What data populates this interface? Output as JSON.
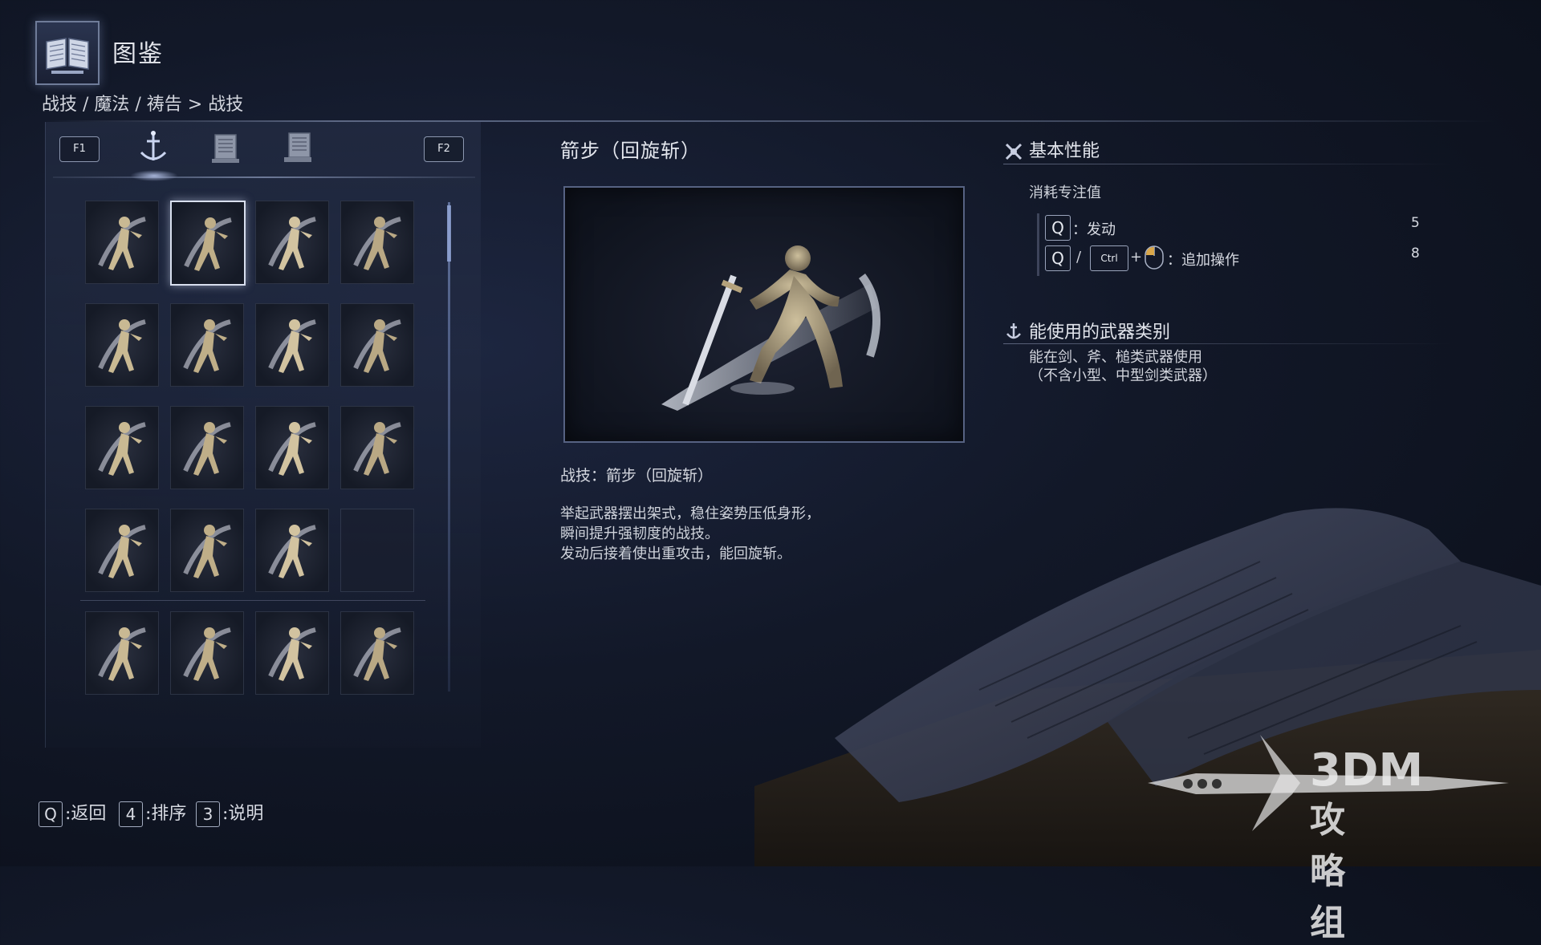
{
  "header": {
    "title": "图鉴",
    "icon": "book-icon"
  },
  "breadcrumb": "战技 / 魔法 / 祷告 > 战技",
  "tabs": {
    "f1_key": "F1",
    "f2_key": "F2",
    "items": [
      {
        "icon": "ash-of-war-icon",
        "active": true
      },
      {
        "icon": "sorcery-scroll-icon",
        "active": false
      },
      {
        "icon": "incantation-scroll-icon",
        "active": false
      }
    ]
  },
  "grid": {
    "selected_index": 1,
    "cells": [
      {
        "icon": "spin-slash-figure-icon"
      },
      {
        "icon": "quickstep-slash-figure-icon"
      },
      {
        "icon": "spinning-weapon-figure-icon"
      },
      {
        "icon": "lion-claw-figure-icon"
      },
      {
        "icon": "crystal-burst-icon"
      },
      {
        "icon": "kick-figure-icon"
      },
      {
        "icon": "roar-figure-icon"
      },
      {
        "icon": "war-cry-figure-icon"
      },
      {
        "icon": "ground-slam-spike-icon"
      },
      {
        "icon": "stomp-figure-icon"
      },
      {
        "icon": "endure-aura-figure-icon"
      },
      {
        "icon": "blood-aura-figure-icon"
      },
      {
        "icon": "blood-tax-figure-icon"
      },
      {
        "icon": "barricade-figure-icon"
      },
      {
        "icon": "vow-figure-icon"
      },
      {
        "icon": "empty-slot"
      },
      {
        "icon": "piercing-thrust-figure-icon"
      },
      {
        "icon": "impaling-thrust-figure-icon"
      },
      {
        "icon": "overhead-strike-figure-icon"
      },
      {
        "icon": "charge-thrust-figure-icon"
      }
    ]
  },
  "skill": {
    "name": "箭步（回旋斩）",
    "subtitle": "战技：箭步（回旋斩）",
    "description": [
      "举起武器摆出架式，稳住姿势压低身形，",
      "瞬间提升强韧度的战技。",
      "发动后接着使出重攻击，能回旋斩。"
    ]
  },
  "stats": {
    "heading": "基本性能",
    "fp_label": "消耗专注值",
    "rows": [
      {
        "key": "Q",
        "label": "：发动",
        "value": "5"
      },
      {
        "key": "Q",
        "sep": "/",
        "key2": "Ctrl",
        "plus": "+",
        "label": "：追加操作",
        "value": "8"
      }
    ]
  },
  "weapons": {
    "heading": "能使用的武器类别",
    "lines": [
      "能在剑、斧、槌类武器使用",
      "（不含小型、中型剑类武器）"
    ]
  },
  "footer": {
    "hints": [
      {
        "key": "Q",
        "label": ":返回"
      },
      {
        "key": "4",
        "label": ":排序"
      },
      {
        "key": "3",
        "label": ":说明"
      }
    ]
  },
  "watermark": {
    "line1": "3DM",
    "line2": "攻略组"
  }
}
